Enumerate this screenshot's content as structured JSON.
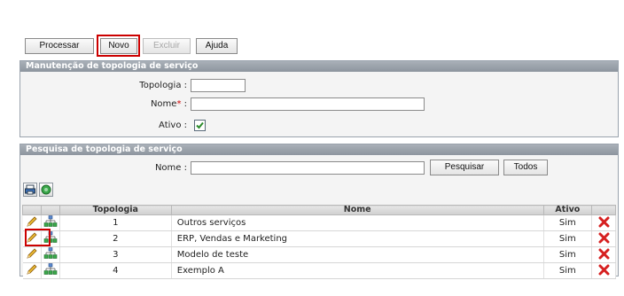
{
  "toolbar": {
    "processar": "Processar",
    "novo": "Novo",
    "excluir": "Excluir",
    "ajuda": "Ajuda"
  },
  "maintenance": {
    "title": "Manutenção de topologia de serviço",
    "topologia_label": "Topologia :",
    "topologia_value": "",
    "nome_label": "Nome",
    "nome_required": "*",
    "nome_colon": " :",
    "nome_value": "",
    "ativo_label": "Ativo :",
    "ativo_checked": true
  },
  "search": {
    "title": "Pesquisa de topologia de serviço",
    "nome_label": "Nome :",
    "nome_value": "",
    "pesquisar": "Pesquisar",
    "todos": "Todos"
  },
  "table": {
    "headers": [
      "Topologia",
      "Nome",
      "Ativo"
    ],
    "rows": [
      {
        "topologia": "1",
        "nome": "Outros serviços",
        "ativo": "Sim"
      },
      {
        "topologia": "2",
        "nome": "ERP, Vendas e Marketing",
        "ativo": "Sim"
      },
      {
        "topologia": "3",
        "nome": "Modelo de teste",
        "ativo": "Sim"
      },
      {
        "topologia": "4",
        "nome": "Exemplo A",
        "ativo": "Sim"
      }
    ]
  },
  "colors": {
    "panel_header": "#8d959e",
    "highlight": "#cc0000",
    "delete": "#d62020"
  }
}
